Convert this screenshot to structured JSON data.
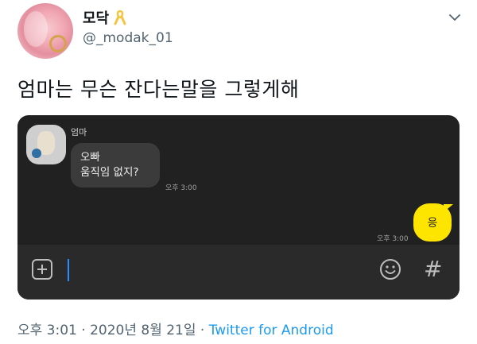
{
  "user": {
    "display_name": "모닥",
    "handle": "@_modak_01"
  },
  "tweet": {
    "text": "엄마는 무슨 잔다는말을 그렇게해"
  },
  "chat": {
    "sender": "엄마",
    "incoming_line1": "오빠",
    "incoming_line2": "움직임 없지?",
    "incoming_time": "오후 3:00",
    "outgoing": "응",
    "outgoing_time": "오후 3:00",
    "hash_symbol": "#"
  },
  "meta": {
    "timestamp": "오후 3:01 · 2020년 8월 21일 · ",
    "source": "Twitter for Android"
  },
  "colors": {
    "chat_background": "#212121",
    "outgoing_bubble": "#fee500",
    "link": "#1d9bf0"
  }
}
